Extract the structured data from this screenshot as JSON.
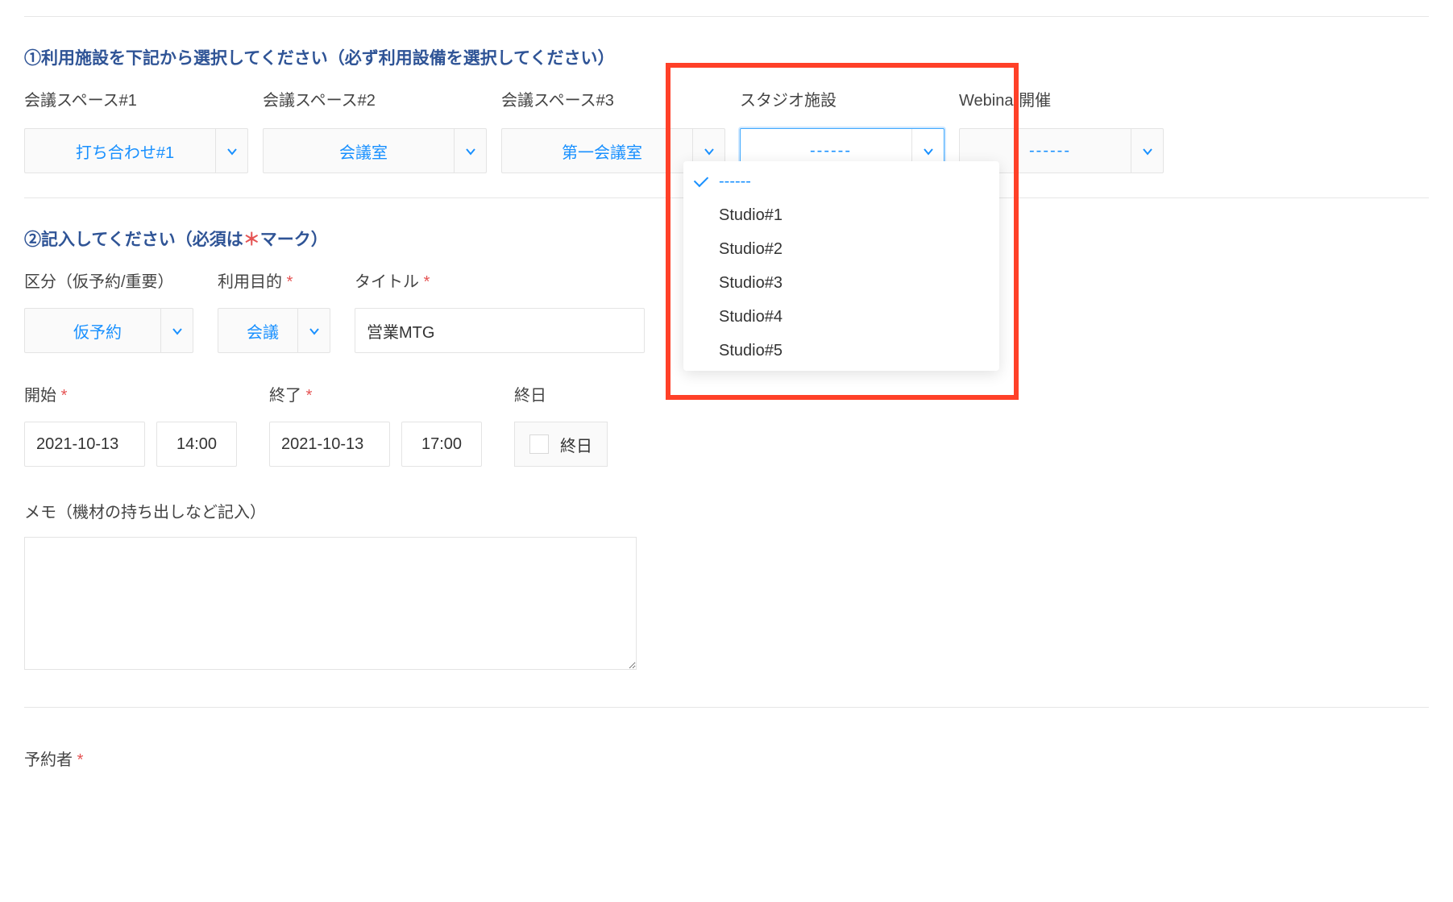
{
  "section1": {
    "title": "①利用施設を下記から選択してください（必ず利用設備を選択してください）",
    "cols": [
      {
        "label": "会議スペース#1",
        "value": "打ち合わせ#1"
      },
      {
        "label": "会議スペース#2",
        "value": "会議室"
      },
      {
        "label": "会議スペース#3",
        "value": "第一会議室"
      },
      {
        "label": "スタジオ施設",
        "value": "------"
      },
      {
        "label": "Webinar開催",
        "value": "------"
      }
    ]
  },
  "studio_options": [
    "------",
    "Studio#1",
    "Studio#2",
    "Studio#3",
    "Studio#4",
    "Studio#5"
  ],
  "section2": {
    "title_pre": "②記入してください（必須は",
    "title_post": "マーク）",
    "kubun": {
      "label": "区分（仮予約/重要）",
      "value": "仮予約"
    },
    "purpose": {
      "label": "利用目的",
      "value": "会議"
    },
    "title_field": {
      "label": "タイトル",
      "value": "営業MTG"
    },
    "start": {
      "label": "開始",
      "date": "2021-10-13",
      "time": "14:00"
    },
    "end": {
      "label": "終了",
      "date": "2021-10-13",
      "time": "17:00"
    },
    "allday": {
      "label": "終日",
      "text": "終日"
    },
    "memo": {
      "label": "メモ（機材の持ち出しなど記入）",
      "value": ""
    }
  },
  "section3": {
    "reserver_label": "予約者"
  }
}
